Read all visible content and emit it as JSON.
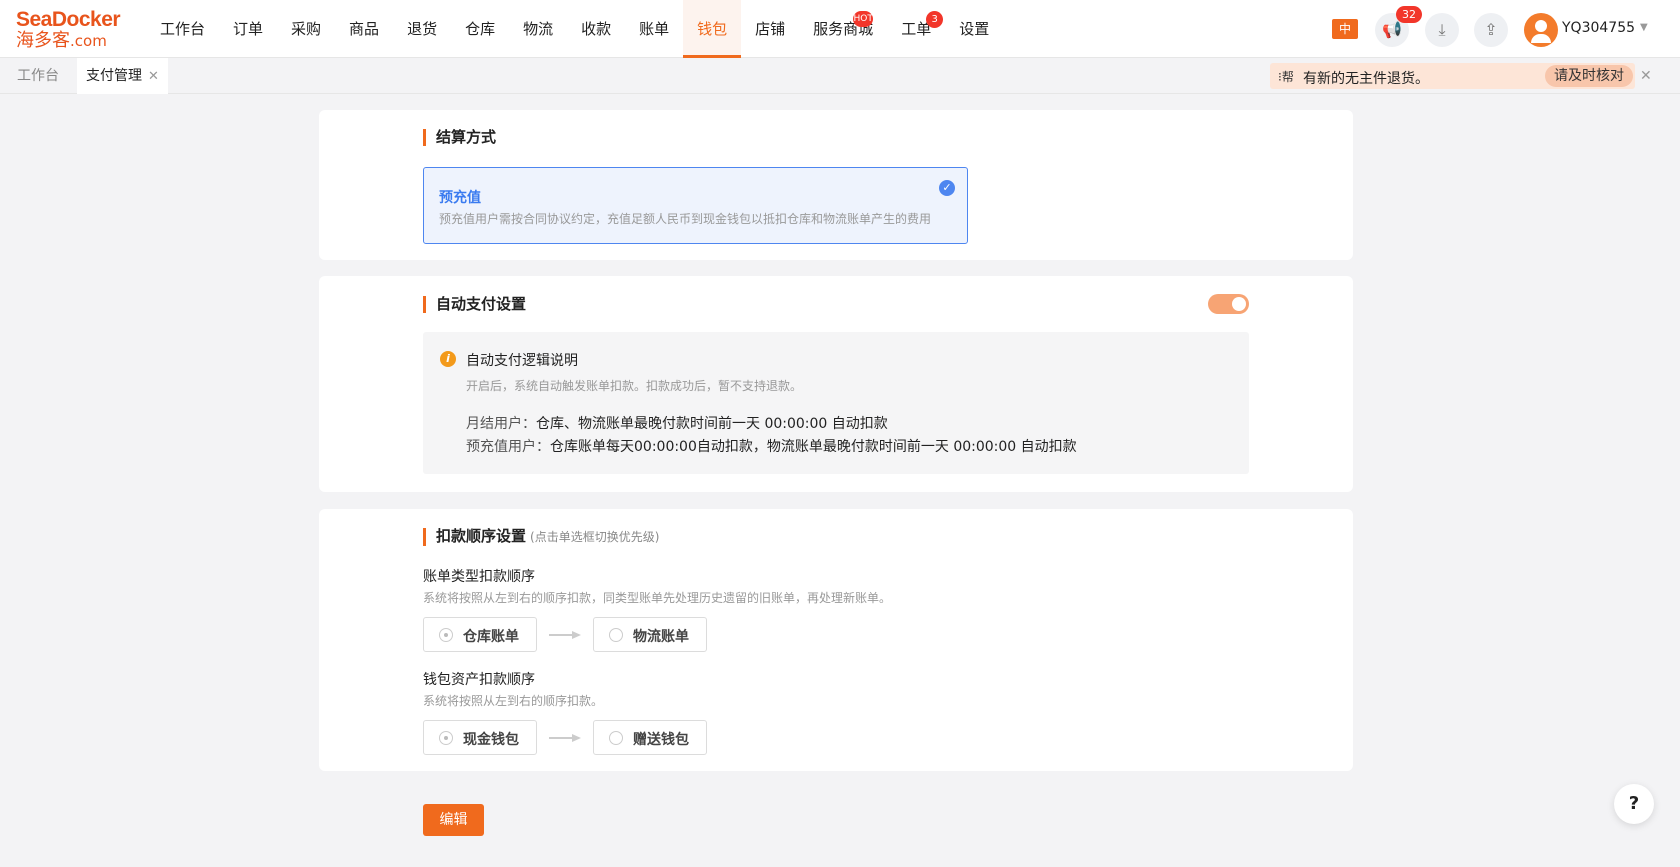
{
  "brand": {
    "name_en": "SeaDocker",
    "name_cn": "海多客",
    "domain_suffix": ".com",
    "accent": "#f06a1d"
  },
  "nav": {
    "items": [
      {
        "label": "工作台"
      },
      {
        "label": "订单"
      },
      {
        "label": "采购"
      },
      {
        "label": "商品"
      },
      {
        "label": "退货"
      },
      {
        "label": "仓库"
      },
      {
        "label": "物流"
      },
      {
        "label": "收款"
      },
      {
        "label": "账单"
      },
      {
        "label": "钱包",
        "active": true
      },
      {
        "label": "店铺"
      },
      {
        "label": "服务商城",
        "badge": "HOT"
      },
      {
        "label": "工单",
        "badge": "3"
      },
      {
        "label": "设置"
      }
    ]
  },
  "topbar": {
    "lang": "中",
    "announcement_count": "32",
    "icons": [
      "megaphone-icon",
      "download-icon",
      "share-icon"
    ],
    "user": "YQ304755"
  },
  "tabs": [
    {
      "label": "工作台"
    },
    {
      "label": "支付管理",
      "active": true
    }
  ],
  "notice": {
    "icon": "⁝帮",
    "text": "有新的无主件退货。",
    "action": "请及时核对"
  },
  "settlement": {
    "title": "结算方式",
    "option": {
      "name": "预充值",
      "desc": "预充值用户需按合同协议约定，充值足额人民币到现金钱包以抵扣仓库和物流账单产生的费用",
      "selected": true
    }
  },
  "autopay": {
    "title": "自动支付设置",
    "enabled": true,
    "info_title": "自动支付逻辑说明",
    "info_sub": "开启后，系统自动触发账单扣款。扣款成功后，暂不支持退款。",
    "monthly_label": "月结用户：",
    "monthly_text": "仓库、物流账单最晚付款时间前一天 00:00:00 自动扣款",
    "prepay_label": "预充值用户：",
    "prepay_text": "仓库账单每天00:00:00自动扣款，物流账单最晚付款时间前一天 00:00:00 自动扣款"
  },
  "deduction": {
    "title": "扣款顺序设置",
    "hint": "(点击单选框切换优先级)",
    "bill_title": "账单类型扣款顺序",
    "bill_desc": "系统将按照从左到右的顺序扣款，同类型账单先处理历史遗留的旧账单，再处理新账单。",
    "bill_options": [
      "仓库账单",
      "物流账单"
    ],
    "wallet_title": "钱包资产扣款顺序",
    "wallet_desc": "系统将按照从左到右的顺序扣款。",
    "wallet_options": [
      "现金钱包",
      "赠送钱包"
    ]
  },
  "actions": {
    "edit": "编辑",
    "help": "?"
  }
}
